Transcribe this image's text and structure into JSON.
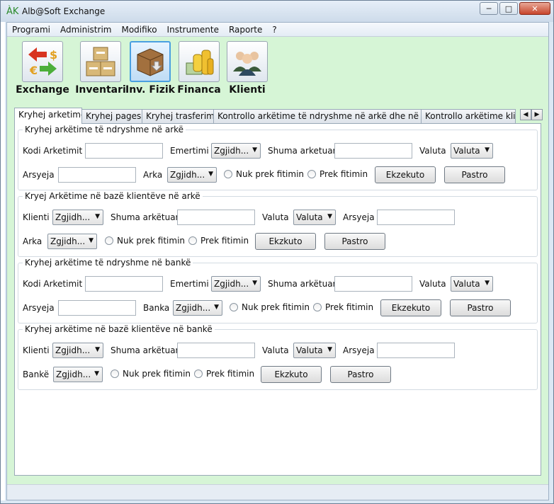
{
  "window": {
    "title": "Alb@Soft Exchange",
    "app_icon_text": "ÀK"
  },
  "menu": [
    "Programi",
    "Administrim",
    "Modifiko",
    "Instrumente",
    "Raporte",
    "?"
  ],
  "toolbar": [
    {
      "label": "Exchange",
      "icon": "currency-exchange-icon"
    },
    {
      "label": "Inventari",
      "icon": "boxes-icon"
    },
    {
      "label": "Inv. Fizik",
      "icon": "box-download-icon"
    },
    {
      "label": "Financa",
      "icon": "coins-money-icon"
    },
    {
      "label": "Klienti",
      "icon": "users-icon"
    }
  ],
  "tabs": [
    "Kryhej arketime",
    "Kryhej pagesa",
    "Kryhej trasferime",
    "Kontrollo arkëtime të ndryshme në arkë dhe në bankë",
    "Kontrollo arkëtime klien"
  ],
  "group1": {
    "title": "Kryhej arkëtime të ndryshme në arkë",
    "kodi_label": "Kodi Arketimit",
    "emertimi_label": "Emertimi",
    "emertimi_value": "Zgjidh...",
    "shuma_label": "Shuma arketuar",
    "valuta_label": "Valuta",
    "valuta_value": "Valuta",
    "arsyeja_label": "Arsyeja",
    "arka_label": "Arka",
    "arka_value": "Zgjidh...",
    "radio1": "Nuk prek fitimin",
    "radio2": "Prek fitimin",
    "exec_button": "Ekzekuto",
    "clear_button": "Pastro"
  },
  "group2": {
    "title": "Kryej Arkëtime në bazë klientëve në arkë",
    "klienti_label": "Klienti",
    "klienti_value": "Zgjidh...",
    "shuma_label": "Shuma arkëtuar",
    "valuta_label": "Valuta",
    "valuta_value": "Valuta",
    "arsyeja_label": "Arsyeja",
    "arka_label": "Arka",
    "arka_value": "Zgjidh...",
    "radio1": "Nuk prek fitimin",
    "radio2": "Prek fitimin",
    "exec_button": "Ekzkuto",
    "clear_button": "Pastro"
  },
  "group3": {
    "title": "Kryhej arkëtime të ndryshme në bankë",
    "kodi_label": "Kodi Arketimit",
    "emertimi_label": "Emertimi",
    "emertimi_value": "Zgjidh...",
    "shuma_label": "Shuma arkëtuar",
    "valuta_label": "Valuta",
    "valuta_value": "Valuta",
    "arsyeja_label": "Arsyeja",
    "banka_label": "Banka",
    "banka_value": "Zgjidh...",
    "radio1": "Nuk prek fitimin",
    "radio2": "Prek fitimin",
    "exec_button": "Ekzekuto",
    "clear_button": "Pastro"
  },
  "group4": {
    "title": "Kryhej arkëtime në bazë klientëve në bankë",
    "klienti_label": "Klienti",
    "klienti_value": "Zgjidh...",
    "shuma_label": "Shuma arkëtuar",
    "valuta_label": "Valuta",
    "valuta_value": "Valuta",
    "arsyeja_label": "Arsyeja",
    "banke_label": "Bankë",
    "banke_value": "Zgjidh...",
    "radio1": "Nuk prek fitimin",
    "radio2": "Prek fitimin",
    "exec_button": "Ekzkuto",
    "clear_button": "Pastro"
  },
  "colors": {
    "client_bg": "#d6f5d6",
    "panel_bg": "#ffffff",
    "close_button": "#c7452b",
    "active_tool_border": "#4aa0e0"
  }
}
